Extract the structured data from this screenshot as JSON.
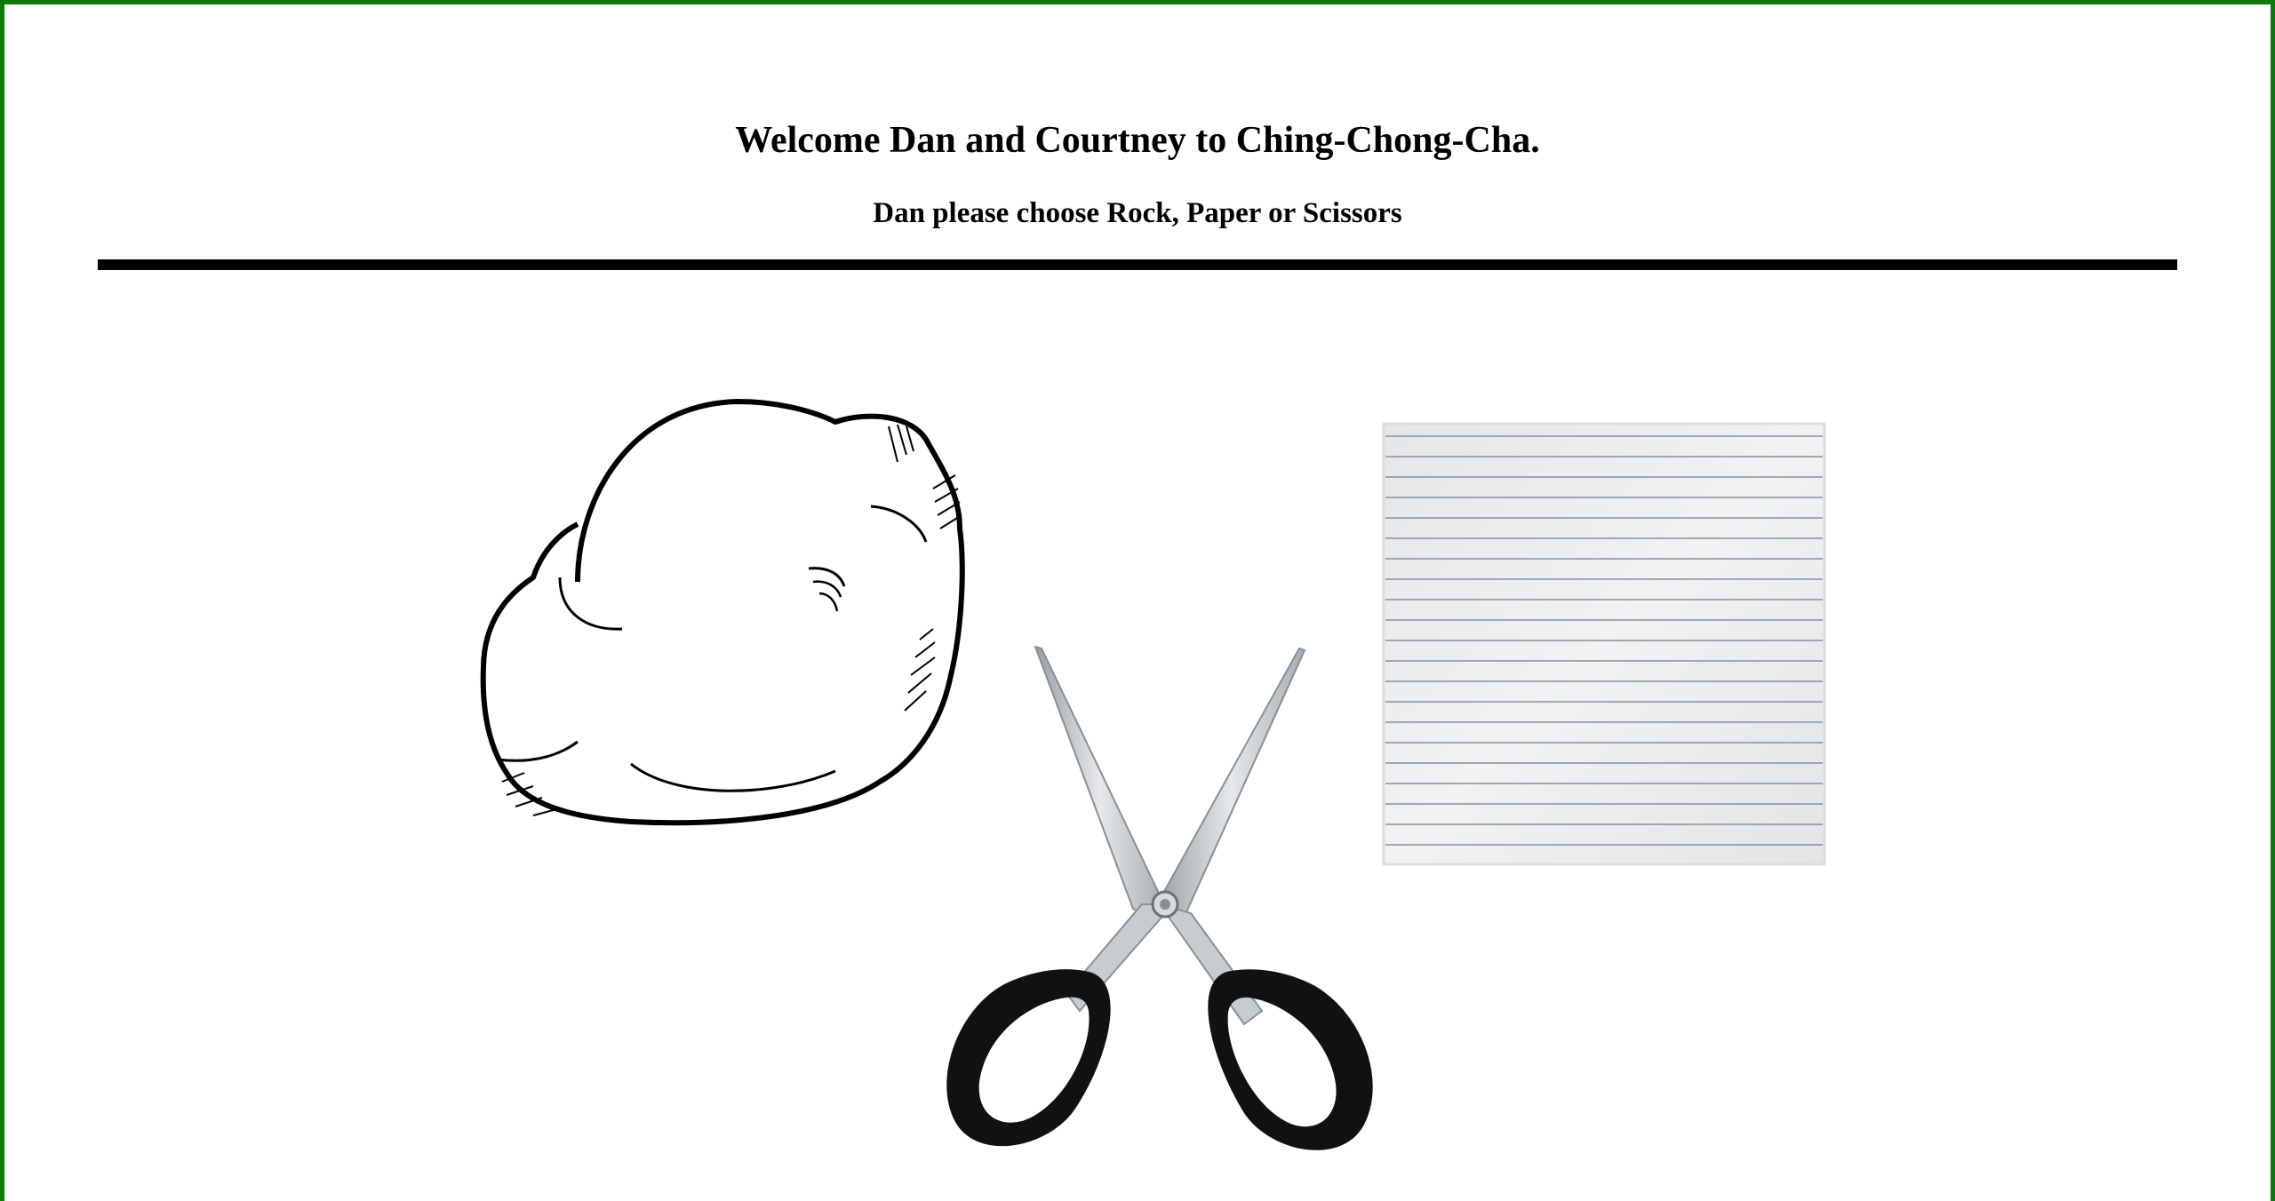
{
  "header": {
    "title": "Welcome Dan and Courtney to Ching-Chong-Cha.",
    "prompt": "Dan please choose Rock, Paper or Scissors"
  },
  "choices": [
    {
      "id": "rock",
      "icon": "rock-icon"
    },
    {
      "id": "paper",
      "icon": "paper-icon"
    },
    {
      "id": "scissors",
      "icon": "scissors-icon"
    }
  ],
  "colors": {
    "border": "#0b7a0b",
    "divider": "#000000"
  }
}
